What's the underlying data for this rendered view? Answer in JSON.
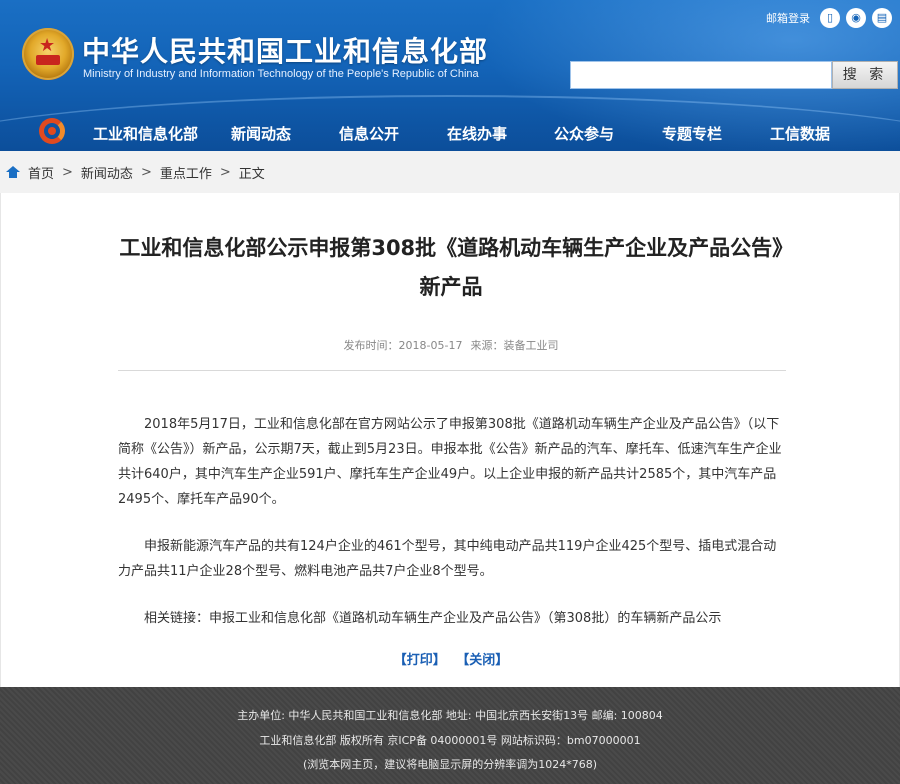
{
  "header": {
    "title_cn": "中华人民共和国工业和信息化部",
    "title_en": "Ministry of Industry and Information Technology of the People's Republic of China",
    "mail_label": "邮箱登录",
    "search_button": "搜 索",
    "search_placeholder": ""
  },
  "nav": {
    "items": [
      {
        "label": "工业和信息化部"
      },
      {
        "label": "新闻动态"
      },
      {
        "label": "信息公开"
      },
      {
        "label": "在线办事"
      },
      {
        "label": "公众参与"
      },
      {
        "label": "专题专栏"
      },
      {
        "label": "工信数据"
      }
    ]
  },
  "breadcrumb": {
    "items": [
      "首页",
      "新闻动态",
      "重点工作",
      "正文"
    ],
    "separator": ">"
  },
  "article": {
    "title": "工业和信息化部公示申报第308批《道路机动车辆生产企业及产品公告》新产品",
    "meta_date_label": "发布时间：2018-05-17",
    "meta_source_label": "来源：装备工业司",
    "paragraphs": [
      "2018年5月17日，工业和信息化部在官方网站公示了申报第308批《道路机动车辆生产企业及产品公告》（以下简称《公告》）新产品，公示期7天，截止到5月23日。申报本批《公告》新产品的汽车、摩托车、低速汽车生产企业共计640户，其中汽车生产企业591户、摩托车生产企业49户。以上企业申报的新产品共计2585个，其中汽车产品2495个、摩托车产品90个。",
      "申报新能源汽车产品的共有124户企业的461个型号，其中纯电动产品共119户企业425个型号、插电式混合动力产品共11户企业28个型号、燃料电池产品共7户企业8个型号。",
      "相关链接：申报工业和信息化部《道路机动车辆生产企业及产品公告》（第308批）的车辆新产品公示"
    ],
    "print_label": "【打印】",
    "close_label": "【关闭】"
  },
  "footer": {
    "line1": "主办单位: 中华人民共和国工业和信息化部 地址: 中国北京西长安街13号 邮编: 100804",
    "line2": "工业和信息化部 版权所有 京ICP备 04000001号    网站标识码：bm07000001",
    "line3": "(浏览本网主页，建议将电脑显示屏的分辨率调为1024*768)"
  },
  "colors": {
    "header_blue": "#1363b7",
    "link_blue": "#1a5fb4",
    "footer_gray": "#454545"
  },
  "icons": [
    "national-emblem-icon",
    "mobile-icon",
    "rss-icon",
    "weibo-icon",
    "miit-logo-icon",
    "home-icon"
  ]
}
